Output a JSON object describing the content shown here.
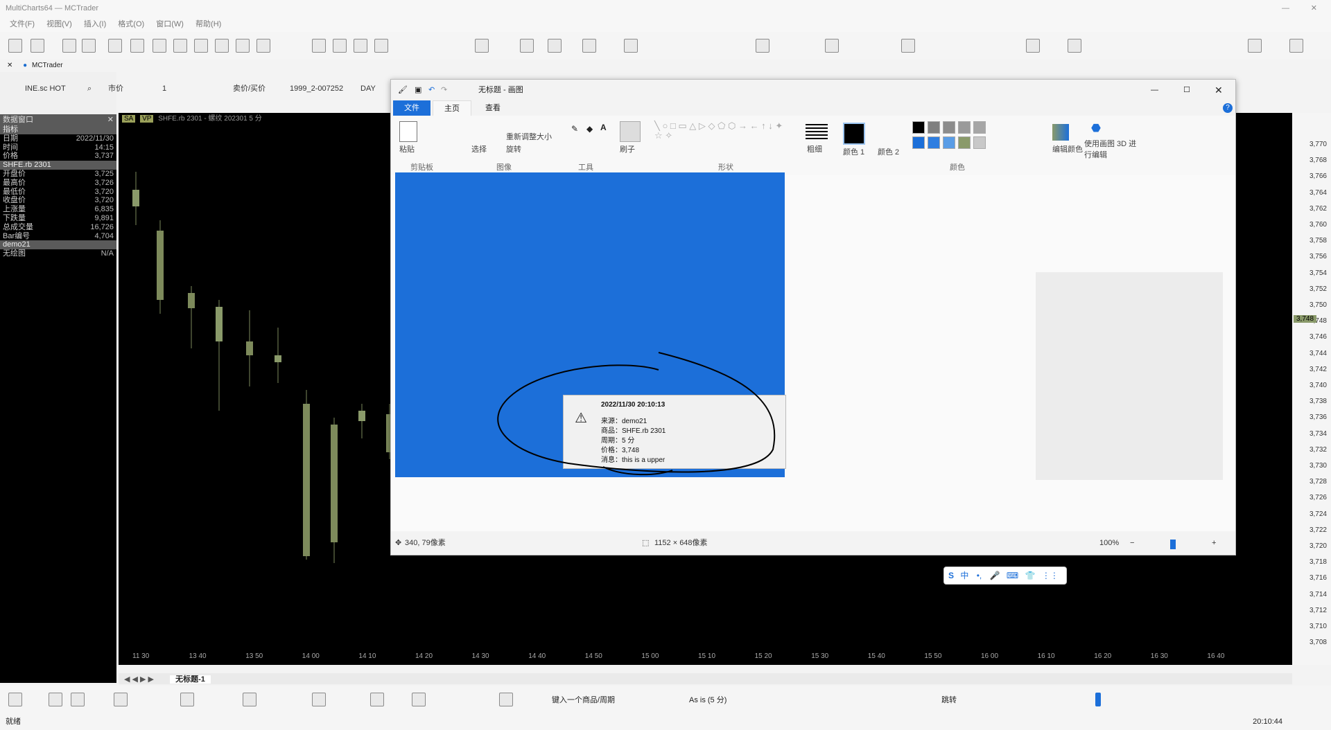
{
  "app": {
    "title": "MultiCharts64 — MCTrader",
    "menus": [
      "文件(F)",
      "视图(V)",
      "插入(I)",
      "格式(O)",
      "窗口(W)",
      "帮助(H)"
    ],
    "workspace_tab": "MCTrader",
    "status_left": "就绪",
    "clock": "20:10:44"
  },
  "symbol_bar": {
    "symbol": "INE.sc HOT",
    "price_type": "市价",
    "quantity": "1",
    "side": "卖价/买价",
    "account": "1999_2-007252",
    "tif": "DAY"
  },
  "data_window": {
    "title": "数据窗口",
    "rows": [
      {
        "label": "指标",
        "value": "",
        "header": true
      },
      {
        "label": "日期",
        "value": "2022/11/30"
      },
      {
        "label": "时间",
        "value": "14:15"
      },
      {
        "label": "价格",
        "value": "3,737"
      },
      {
        "label": "SHFE.rb 2301",
        "value": "",
        "header": true
      },
      {
        "label": "开盘价",
        "value": "3,725"
      },
      {
        "label": "最高价",
        "value": "3,726"
      },
      {
        "label": "最低价",
        "value": "3,720"
      },
      {
        "label": "收盘价",
        "value": "3,720"
      },
      {
        "label": "上涨量",
        "value": "6,835"
      },
      {
        "label": "下跌量",
        "value": "9,891"
      },
      {
        "label": "总成交量",
        "value": "16,726"
      },
      {
        "label": "Bar编号",
        "value": "4,704"
      },
      {
        "label": "demo21",
        "value": "",
        "header": true
      },
      {
        "label": "无绘图",
        "value": "N/A"
      }
    ]
  },
  "chart": {
    "header": "SHFE.rb 2301 - 螺纹 202301 5 分",
    "tags": [
      "SA",
      "VP"
    ],
    "current_price": "3,748",
    "price_ticks": [
      "3,770",
      "3,768",
      "3,766",
      "3,764",
      "3,762",
      "3,760",
      "3,758",
      "3,756",
      "3,754",
      "3,752",
      "3,750",
      "3,748",
      "3,746",
      "3,744",
      "3,742",
      "3,740",
      "3,738",
      "3,736",
      "3,734",
      "3,732",
      "3,730",
      "3,728",
      "3,726",
      "3,724",
      "3,722",
      "3,720",
      "3,718",
      "3,716",
      "3,714",
      "3,712",
      "3,710",
      "3,708"
    ],
    "time_ticks": [
      "11 30",
      "13 40",
      "13 50",
      "14 00",
      "14 10",
      "14 20",
      "14 30",
      "14 40",
      "14 50",
      "15 00",
      "15 10",
      "15 20",
      "15 30",
      "15 40",
      "15 50",
      "16 00",
      "16 10",
      "16 20",
      "16 30",
      "16 40"
    ],
    "sheet_tab": "无标题-1",
    "series_label": "As is (5 分)",
    "symbol_input_placeholder": "键入一个商品/周期",
    "jump_label": "跳转",
    "colors": {
      "candle_up": "#8a9a6a",
      "candle_down": "#7d8a5b",
      "background": "#000000"
    }
  },
  "paint": {
    "title": "无标题 - 画图",
    "tabs": [
      "文件",
      "主页",
      "查看"
    ],
    "groups": [
      "剪贴板",
      "图像",
      "工具",
      "形状",
      "颜色"
    ],
    "paste": "粘贴",
    "select": "选择",
    "resize": "重新调整大小",
    "rotate": "旋转",
    "brush": "刷子",
    "size": "粗细",
    "color1": "颜色 1",
    "color2": "颜色 2",
    "edit_colors": "编辑颜色",
    "paint3d": "使用画图 3D 进行编辑",
    "cursor_pos": "340, 79像素",
    "canvas_size": "1152 × 648像素",
    "zoom": "100%",
    "palette": [
      "#000000",
      "#7f7f7f",
      "#8c8c8c",
      "#9a9a9a",
      "#a6a6a6",
      "#1c6fd9",
      "#2f7ee0",
      "#5a9de6",
      "#8a9a6a",
      "#c8c8c8"
    ],
    "alert": {
      "datetime": "2022/11/30 20:10:13",
      "source": "来源：demo21",
      "symbol": "商品：SHFE.rb 2301",
      "period": "周期：5 分",
      "price": "价格：3,748",
      "message": "消息：this is a upper"
    }
  },
  "ime": {
    "label": "中"
  }
}
